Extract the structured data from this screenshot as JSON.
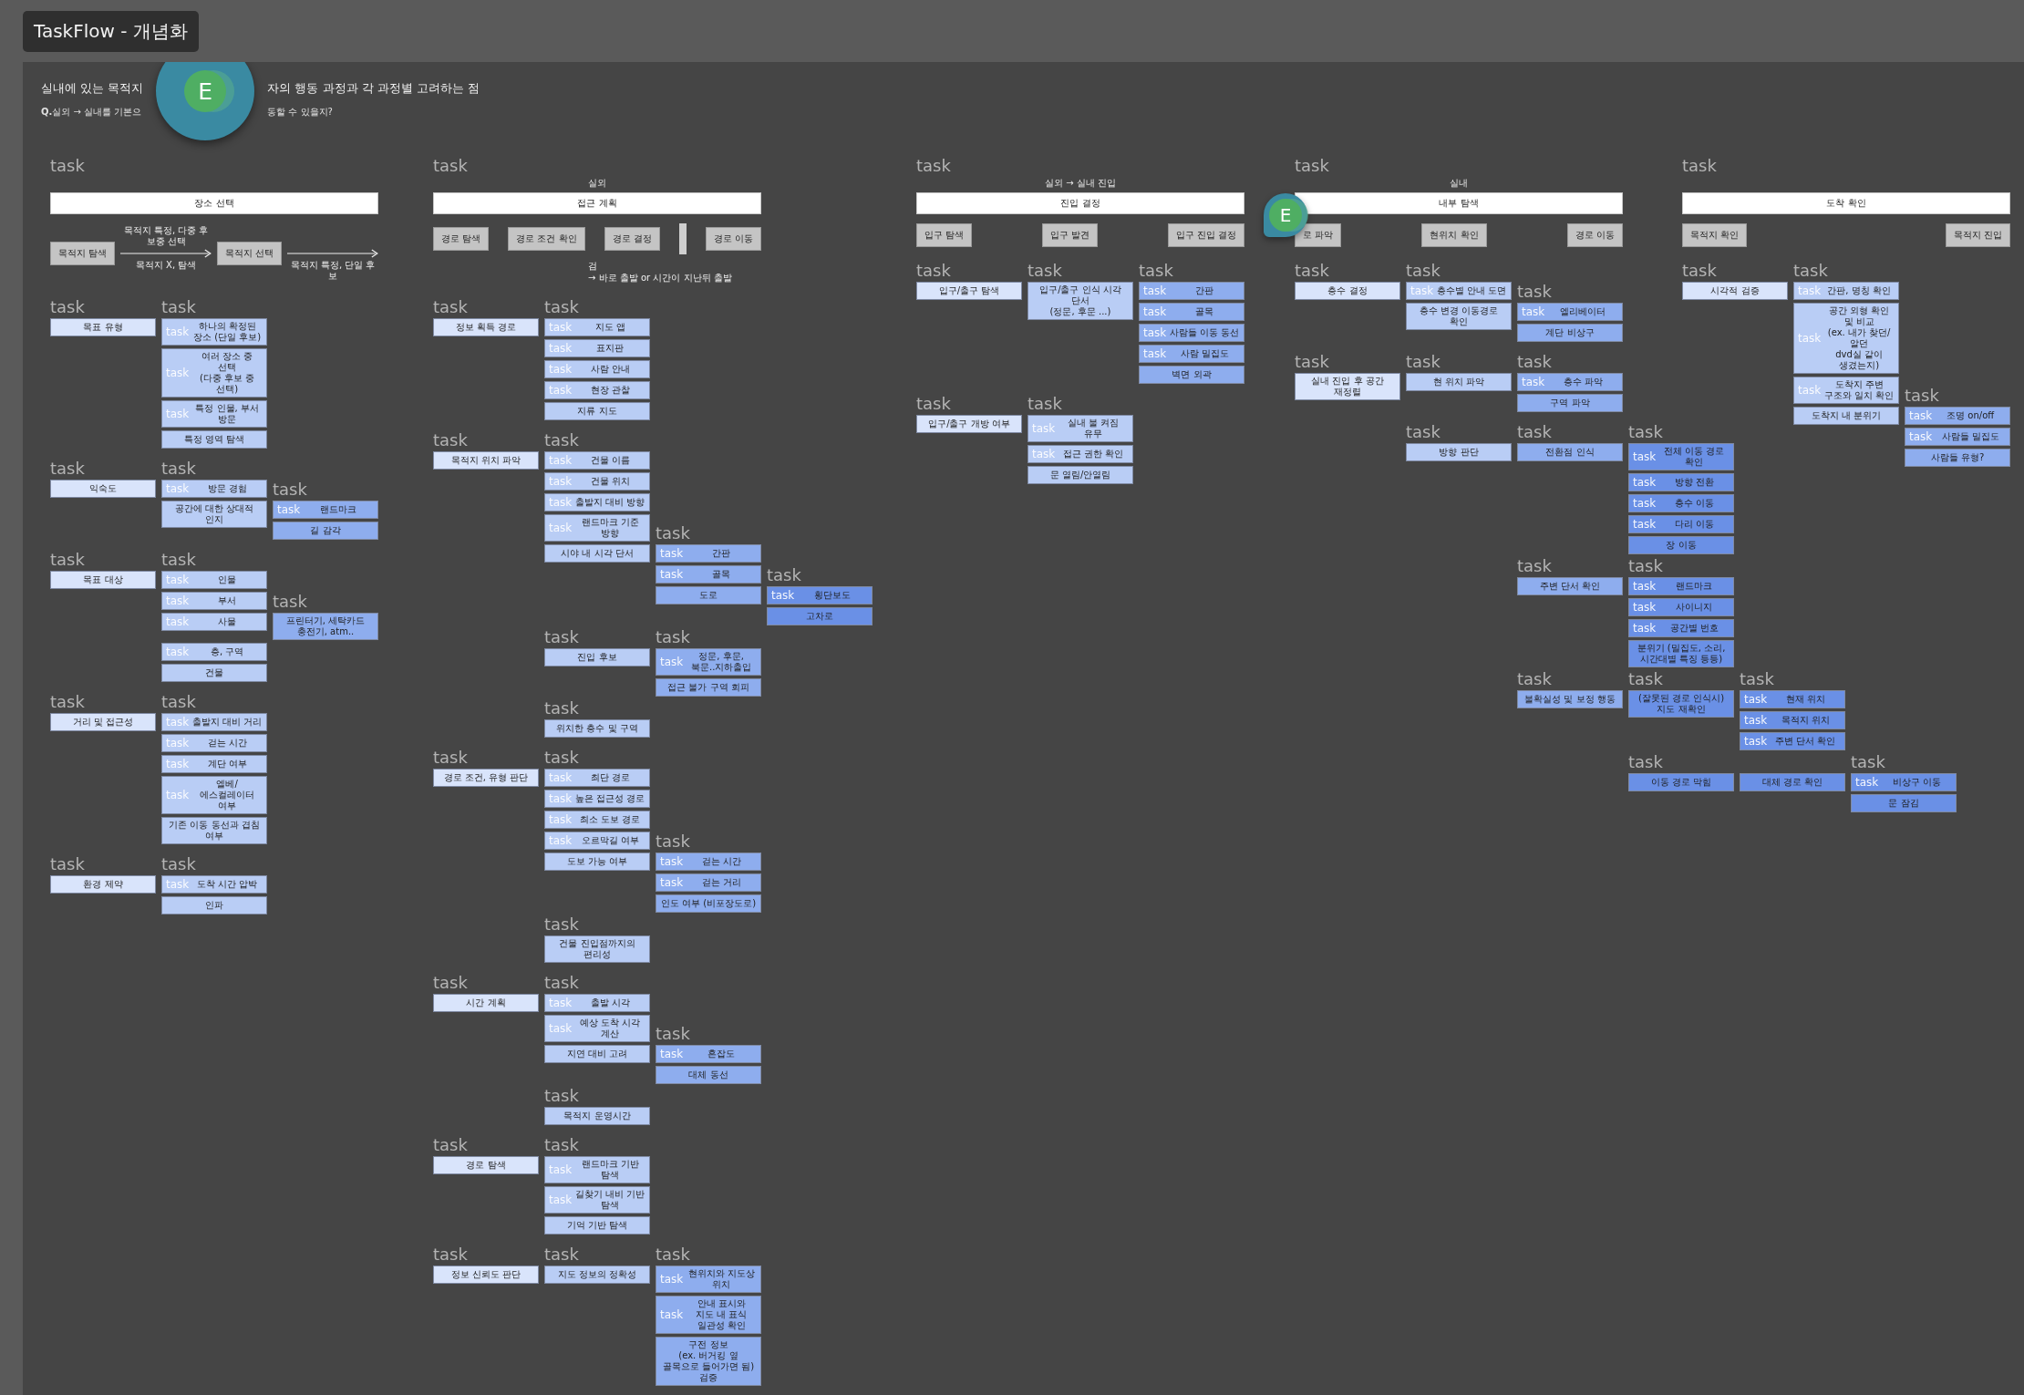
{
  "document": {
    "title": "TaskFlow - 개념화"
  },
  "heading": {
    "title": [
      "실내에 있는 목적지",
      "자의 행동 과정과 각 과정별 고려하는 점"
    ],
    "subtitle": [
      "**Q.**실외 → 실내를 기본으",
      "동할 수 있을지?"
    ],
    "avatar": {
      "initial": "E"
    }
  },
  "sections": [
    {
      "label": "task",
      "title": "장소 선택",
      "steps": [
        {
          "kind": "box",
          "text": "목적지 탐색"
        },
        {
          "kind": "arrow",
          "above": "목적지 특정, 다중 후보중 선택",
          "below": "목적지 X, 탐색"
        },
        {
          "kind": "box",
          "text": "목적지 선택"
        },
        {
          "kind": "arrow",
          "below": "목적지 특정, 단일 후보"
        }
      ],
      "groups": [
        {
          "text": "목표 유형",
          "label": "task",
          "children": [
            {
              "text": "하나의 확정된 장소 (단일 후보)",
              "label": "task",
              "tag": "task"
            },
            {
              "text": "여러 장소 중 선택\n(다중 후보 중 선택)",
              "tag": "task"
            },
            {
              "text": "특정 인물, 부서 방문",
              "tag": "task"
            },
            {
              "text": "특정 영역 탐색"
            }
          ]
        },
        {
          "text": "익숙도",
          "label": "task",
          "children": [
            {
              "text": "방문 경험",
              "label": "task",
              "tag": "task"
            },
            {
              "text": "공간에 대한 상대적 인지",
              "children": [
                {
                  "text": "랜드마크",
                  "label": "task",
                  "tag": "task"
                },
                {
                  "text": "길 감각"
                }
              ]
            }
          ]
        },
        {
          "text": "목표 대상",
          "label": "task",
          "children": [
            {
              "text": "인물",
              "label": "task",
              "tag": "task"
            },
            {
              "text": "부서",
              "tag": "task"
            },
            {
              "text": "사물",
              "tag": "task",
              "children": [
                {
                  "text": "프린터기, 세탁카드 충전기, atm..",
                  "label": "task"
                }
              ]
            },
            {
              "text": "층, 구역",
              "tag": "task"
            },
            {
              "text": "건물"
            }
          ]
        },
        {
          "text": "거리 및 접근성",
          "label": "task",
          "children": [
            {
              "text": "출발지 대비 거리",
              "label": "task",
              "tag": "task"
            },
            {
              "text": "걷는 시간",
              "tag": "task"
            },
            {
              "text": "계단 여부",
              "tag": "task"
            },
            {
              "text": "엘베/에스컬레이터 여부",
              "tag": "task"
            },
            {
              "text": "기존 이동 동선과 겹침 여부"
            }
          ]
        },
        {
          "text": "환경 제약",
          "label": "task",
          "children": [
            {
              "text": "도착 시간 압박",
              "label": "task",
              "tag": "task"
            },
            {
              "text": "인파"
            }
          ]
        }
      ]
    },
    {
      "label": "task",
      "context": "실외",
      "title": "접근 계획",
      "steps": [
        {
          "kind": "box",
          "text": "경로 탐색"
        },
        {
          "kind": "box",
          "text": "경로 조건 확인"
        },
        {
          "kind": "box",
          "text": "경로 결정"
        },
        {
          "kind": "divider",
          "note": "검\n→ 바로 출발 or 시간이 지난뒤 출발"
        },
        {
          "kind": "box",
          "text": "경로 이동"
        }
      ],
      "groups": [
        {
          "text": "정보 획득 경로",
          "label": "task",
          "children": [
            {
              "text": "지도 앱",
              "label": "task",
              "tag": "task"
            },
            {
              "text": "표지판",
              "tag": "task"
            },
            {
              "text": "사람 안내",
              "tag": "task"
            },
            {
              "text": "현장 관찰",
              "tag": "task"
            },
            {
              "text": "지류 지도"
            }
          ]
        },
        {
          "text": "목적지 위치 파악",
          "label": "task",
          "children": [
            {
              "text": "건물 이름",
              "label": "task",
              "tag": "task"
            },
            {
              "text": "건물 위치",
              "tag": "task"
            },
            {
              "text": "출발지 대비 방향",
              "tag": "task"
            },
            {
              "text": "랜드마크 기준 방향",
              "tag": "task"
            },
            {
              "text": "시야 내 시각 단서",
              "children": [
                {
                  "text": "간판",
                  "label": "task",
                  "tag": "task"
                },
                {
                  "text": "골목",
                  "tag": "task"
                },
                {
                  "text": "도로",
                  "children": [
                    {
                      "text": "횡단보도",
                      "label": "task",
                      "tag": "task"
                    },
                    {
                      "text": "고차로"
                    }
                  ]
                }
              ]
            },
            {
              "text": "진입 후보",
              "label": "task",
              "children": [
                {
                  "text": "정문, 후문, 북문..지하출입",
                  "label": "task",
                  "tag": "task"
                },
                {
                  "text": "접근 불가 구역 회피"
                }
              ]
            },
            {
              "text": "위치한 층수 및 구역",
              "label": "task"
            }
          ]
        },
        {
          "text": "경로 조건, 유형 판단",
          "label": "task",
          "children": [
            {
              "text": "최단 경로",
              "label": "task",
              "tag": "task"
            },
            {
              "text": "높은 접근성 경로",
              "tag": "task"
            },
            {
              "text": "최소 도보 경로",
              "tag": "task"
            },
            {
              "text": "오르막길 여부",
              "tag": "task"
            },
            {
              "text": "도보 가능 여부",
              "children": [
                {
                  "text": "걷는 시간",
                  "label": "task",
                  "tag": "task"
                },
                {
                  "text": "걷는 거리",
                  "tag": "task"
                },
                {
                  "text": "인도 여부 (비포장도로)"
                }
              ]
            },
            {
              "text": "건물 진입점까지의 편리성",
              "label": "task"
            }
          ]
        },
        {
          "text": "시간 계획",
          "label": "task",
          "children": [
            {
              "text": "출발 시각",
              "label": "task",
              "tag": "task"
            },
            {
              "text": "예상 도착 시각 계산",
              "tag": "task"
            },
            {
              "text": "지연 대비 고려",
              "children": [
                {
                  "text": "혼잡도",
                  "label": "task",
                  "tag": "task"
                },
                {
                  "text": "대체 동선"
                }
              ]
            },
            {
              "text": "목적지 운영시간",
              "label": "task"
            }
          ]
        },
        {
          "text": "경로 탐색",
          "label": "task",
          "children": [
            {
              "text": "랜드마크 기반 탐색",
              "label": "task",
              "tag": "task"
            },
            {
              "text": "길찾기 내비 기반 탐색",
              "tag": "task"
            },
            {
              "text": "기억 기반 탐색"
            }
          ]
        },
        {
          "text": "정보 신뢰도 판단",
          "label": "task",
          "children": [
            {
              "text": "지도 정보의 정확성",
              "label": "task",
              "children": [
                {
                  "text": "현위치와 지도상 위치",
                  "label": "task",
                  "tag": "task"
                },
                {
                  "text": "안내 표시와\n지도 내 표식 일관성 확인",
                  "tag": "task"
                },
                {
                  "text": "구전 정보\n(ex. 버거킹 옆 골목으로 들어가면 됨) 검증"
                }
              ]
            }
          ]
        }
      ]
    },
    {
      "label": "task",
      "context": "실외 → 실내 진입",
      "title": "진입 결정",
      "steps": [
        {
          "kind": "box",
          "text": "입구 탐색"
        },
        {
          "kind": "box",
          "text": "입구 발견"
        },
        {
          "kind": "box",
          "text": "입구 진입 결정"
        }
      ],
      "groups": [
        {
          "text": "입구/출구 탐색",
          "label": "task",
          "children": [
            {
              "text": "입구/출구 인식 시각 단서\n(정문, 후문 ...)",
              "label": "task",
              "children": [
                {
                  "text": "간판",
                  "label": "task",
                  "tag": "task"
                },
                {
                  "text": "골목",
                  "tag": "task"
                },
                {
                  "text": "사람들 이동 동선",
                  "tag": "task"
                },
                {
                  "text": "사람 밀집도",
                  "tag": "task"
                },
                {
                  "text": "벽면 외곽"
                }
              ]
            }
          ]
        },
        {
          "text": "입구/출구 개방 여부",
          "label": "task",
          "children": [
            {
              "text": "실내 불 켜짐 유무",
              "label": "task",
              "tag": "task"
            },
            {
              "text": "접근 권한 확인",
              "tag": "task"
            },
            {
              "text": "문 열림/안열림"
            }
          ]
        }
      ]
    },
    {
      "label": "task",
      "context": "실내",
      "title": "내부 탐색",
      "avatar": {
        "initial": "E"
      },
      "steps": [
        {
          "kind": "box",
          "text": "로 파악"
        },
        {
          "kind": "box",
          "text": "현위치 확인"
        },
        {
          "kind": "box",
          "text": "경로 이동"
        }
      ],
      "groups": [
        {
          "text": "층수 결정",
          "label": "task",
          "children": [
            {
              "text": "층수별 안내 도면",
              "label": "task",
              "tag": "task"
            },
            {
              "text": "층수 변경 이동경로 확인",
              "children": [
                {
                  "text": "엘리베이터",
                  "label": "task",
                  "tag": "task"
                },
                {
                  "text": "계단 비상구"
                }
              ]
            }
          ]
        },
        {
          "text": "실내 진입 후 공간 재정렬",
          "label": "task",
          "children": [
            {
              "text": "현 위치 파악",
              "label": "task",
              "children": [
                {
                  "text": "층수 파악",
                  "label": "task",
                  "tag": "task"
                },
                {
                  "text": "구역 파악"
                }
              ]
            }
          ]
        },
        {
          "children": [
            {
              "text": "방향 판단",
              "label": "task",
              "children": [
                {
                  "text": "전환점 인식",
                  "label": "task",
                  "children": [
                    {
                      "text": "전체 이동 경로 확인",
                      "label": "task",
                      "tag": "task"
                    },
                    {
                      "text": "방향 전환",
                      "tag": "task"
                    },
                    {
                      "text": "층수 이동",
                      "tag": "task"
                    },
                    {
                      "text": "다리 이동",
                      "tag": "task"
                    },
                    {
                      "text": "장 이동"
                    }
                  ]
                },
                {
                  "text": "주변 단서 확인",
                  "label": "task",
                  "children": [
                    {
                      "text": "랜드마크",
                      "label": "task",
                      "tag": "task"
                    },
                    {
                      "text": "사이니지",
                      "tag": "task"
                    },
                    {
                      "text": "공간별 번호",
                      "tag": "task"
                    },
                    {
                      "text": "분위기 (밀집도, 소리,\n시간대별 특징 등등)"
                    }
                  ]
                },
                {
                  "text": "불확실성 및 보정 행동",
                  "label": "task",
                  "children": [
                    {
                      "text": "(잘못된 경로 인식시)지도 재확인",
                      "label": "task",
                      "children": [
                        {
                          "text": "현재 위치",
                          "label": "task",
                          "tag": "task"
                        },
                        {
                          "text": "목적지 위치",
                          "tag": "task"
                        },
                        {
                          "text": "주변 단서 확인",
                          "tag": "task"
                        }
                      ]
                    },
                    {
                      "text": "이동 경로 막힘",
                      "label": "task",
                      "children": [
                        {
                          "text": "대체 경로 확인",
                          "children": [
                            {
                              "text": "비상구 이동",
                              "label": "task",
                              "tag": "task"
                            },
                            {
                              "text": "문 잠김"
                            }
                          ]
                        }
                      ]
                    }
                  ]
                }
              ]
            }
          ]
        }
      ]
    },
    {
      "label": "task",
      "title": "도착 확인",
      "steps": [
        {
          "kind": "box",
          "text": "목적지 확인"
        },
        {
          "kind": "box",
          "text": "목적지 진입"
        }
      ],
      "groups": [
        {
          "text": "시각적 검증",
          "label": "task",
          "children": [
            {
              "text": "간판, 명칭 확인",
              "label": "task",
              "tag": "task"
            },
            {
              "text": "공간 외형 확인 및 비교\n(ex. 내가 찾던/알던\ndvd실 같이 생겼는지)",
              "tag": "task"
            },
            {
              "text": "도착지 주변 구조와 일치 확인",
              "tag": "task"
            },
            {
              "text": "도착지 내 분위기",
              "children": [
                {
                  "text": "조명 on/off",
                  "label": "task",
                  "tag": "task"
                },
                {
                  "text": "사람들 밀집도",
                  "tag": "task"
                },
                {
                  "text": "사람들 유형?"
                }
              ]
            }
          ]
        }
      ]
    }
  ]
}
